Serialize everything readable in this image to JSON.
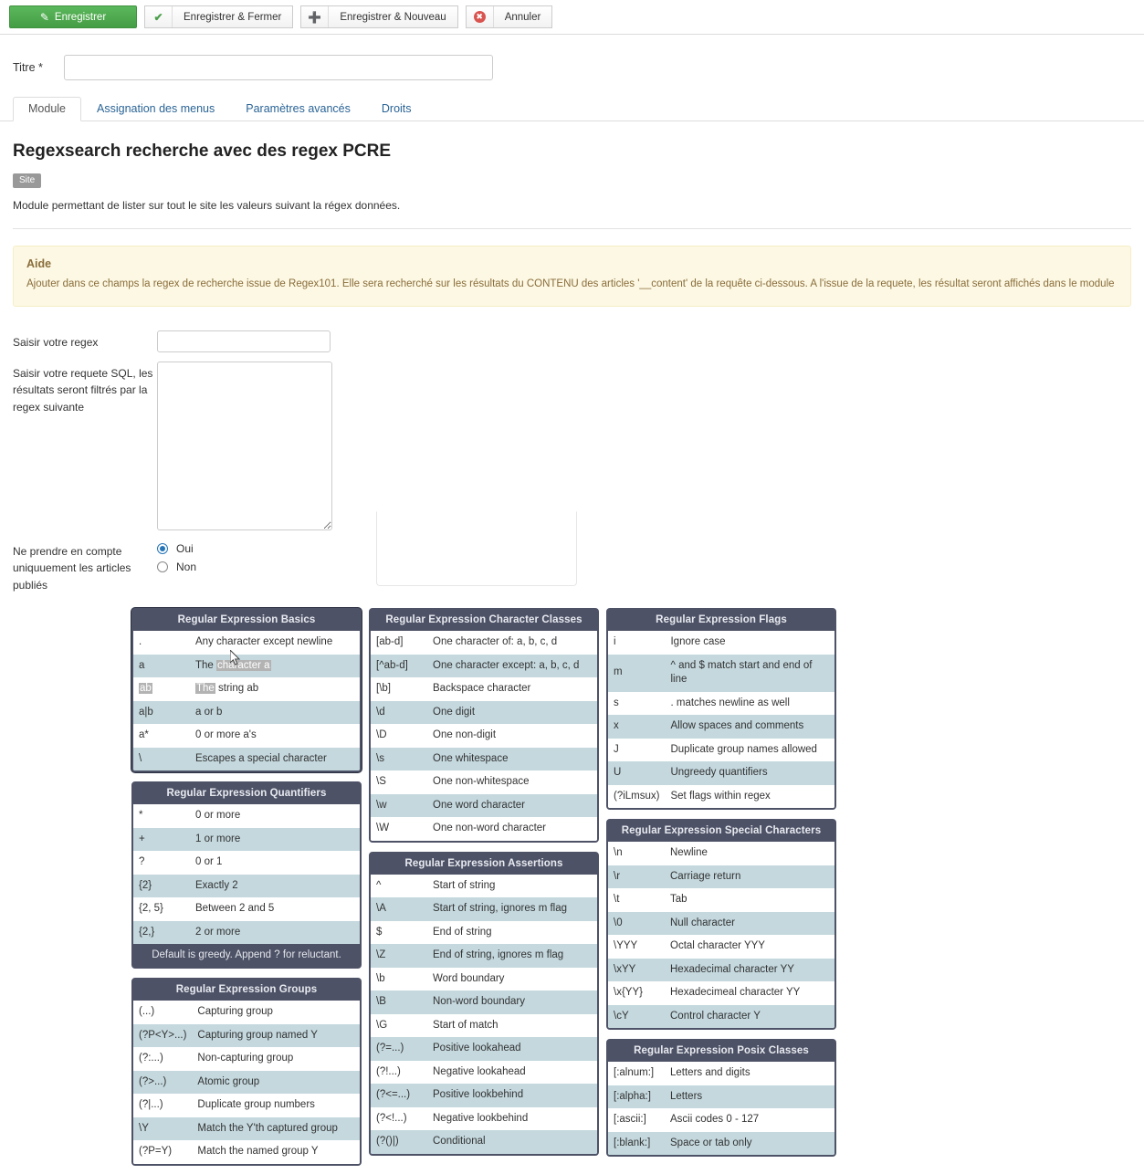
{
  "toolbar": {
    "save": {
      "label": "Enregistrer",
      "icon": "save-icon"
    },
    "save_close": {
      "label": "Enregistrer & Fermer",
      "icon": "check-icon"
    },
    "save_new": {
      "label": "Enregistrer & Nouveau",
      "icon": "plus-icon"
    },
    "cancel": {
      "label": "Annuler",
      "icon": "cancel-icon"
    }
  },
  "title_field": {
    "label": "Titre *",
    "value": "",
    "placeholder": ""
  },
  "tabs": [
    {
      "label": "Module",
      "active": true
    },
    {
      "label": "Assignation des menus",
      "active": false
    },
    {
      "label": "Paramètres avancés",
      "active": false
    },
    {
      "label": "Droits",
      "active": false
    }
  ],
  "module": {
    "heading": "Regexsearch recherche avec des regex PCRE",
    "badge": "Site",
    "description": "Module permettant de lister sur tout le site les valeurs suivant la régex données."
  },
  "alert": {
    "title": "Aide",
    "body": "Ajouter dans ce champs la regex de recherche issue de Regex101. Elle sera recherché sur les résultats du CONTENU des articles '__content' de la requête ci-dessous. A l'issue de la requete, les résultat seront affichés dans le module"
  },
  "form": {
    "regex": {
      "label": "Saisir votre regex",
      "value": "",
      "placeholder": ""
    },
    "sql": {
      "label": "Saisir votre requete SQL, les résultats seront filtrés par la regex suivante",
      "value": "",
      "placeholder": ""
    },
    "published": {
      "label": "Ne prendre en compte uniquuement les articles publiés",
      "options": [
        {
          "label": "Oui",
          "checked": true
        },
        {
          "label": "Non",
          "checked": false
        }
      ]
    }
  },
  "cheatsheet": {
    "basics": {
      "title": "Regular Expression Basics",
      "rows": [
        {
          "key": ".",
          "val": "Any character except newline"
        },
        {
          "key": "a",
          "val": "The character a",
          "sel_val_from": 4
        },
        {
          "key": "ab",
          "val": "The string ab",
          "sel_key": true,
          "sel_val_to": 3
        },
        {
          "key": "a|b",
          "val": "a or b"
        },
        {
          "key": "a*",
          "val": "0 or more a's"
        },
        {
          "key": "\\",
          "val": "Escapes a special character"
        }
      ]
    },
    "quantifiers": {
      "title": "Regular Expression Quantifiers",
      "rows": [
        {
          "key": "*",
          "val": "0 or more"
        },
        {
          "key": "+",
          "val": "1 or more"
        },
        {
          "key": "?",
          "val": "0 or 1"
        },
        {
          "key": "{2}",
          "val": "Exactly 2"
        },
        {
          "key": "{2, 5}",
          "val": "Between 2 and 5"
        },
        {
          "key": "{2,}",
          "val": "2 or more"
        }
      ],
      "footer": "Default is greedy. Append ? for reluctant."
    },
    "groups": {
      "title": "Regular Expression Groups",
      "rows": [
        {
          "key": "(...)",
          "val": "Capturing group"
        },
        {
          "key": "(?P<Y>...)",
          "val": "Capturing group named Y"
        },
        {
          "key": "(?:...)",
          "val": "Non-capturing group"
        },
        {
          "key": "(?>...)",
          "val": "Atomic group"
        },
        {
          "key": "(?|...)",
          "val": "Duplicate group numbers"
        },
        {
          "key": "\\Y",
          "val": "Match the Y'th captured group"
        },
        {
          "key": "(?P=Y)",
          "val": "Match the named group Y"
        }
      ]
    },
    "character_classes": {
      "title": "Regular Expression Character Classes",
      "rows": [
        {
          "key": "[ab-d]",
          "val": "One character of: a, b, c, d"
        },
        {
          "key": "[^ab-d]",
          "val": "One character except: a, b, c, d"
        },
        {
          "key": "[\\b]",
          "val": "Backspace character"
        },
        {
          "key": "\\d",
          "val": "One digit"
        },
        {
          "key": "\\D",
          "val": "One non-digit"
        },
        {
          "key": "\\s",
          "val": "One whitespace"
        },
        {
          "key": "\\S",
          "val": "One non-whitespace"
        },
        {
          "key": "\\w",
          "val": "One word character"
        },
        {
          "key": "\\W",
          "val": "One non-word character"
        }
      ]
    },
    "assertions": {
      "title": "Regular Expression Assertions",
      "rows": [
        {
          "key": "^",
          "val": "Start of string"
        },
        {
          "key": "\\A",
          "val": "Start of string, ignores m flag"
        },
        {
          "key": "$",
          "val": "End of string"
        },
        {
          "key": "\\Z",
          "val": "End of string, ignores m flag"
        },
        {
          "key": "\\b",
          "val": "Word boundary"
        },
        {
          "key": "\\B",
          "val": "Non-word boundary"
        },
        {
          "key": "\\G",
          "val": "Start of match"
        },
        {
          "key": "(?=...)",
          "val": "Positive lookahead"
        },
        {
          "key": "(?!...)",
          "val": "Negative lookahead"
        },
        {
          "key": "(?<=...)",
          "val": "Positive lookbehind"
        },
        {
          "key": "(?<!...)",
          "val": "Negative lookbehind"
        },
        {
          "key": "(?()|)",
          "val": "Conditional"
        }
      ]
    },
    "flags": {
      "title": "Regular Expression Flags",
      "rows": [
        {
          "key": "i",
          "val": "Ignore case"
        },
        {
          "key": "m",
          "val": "^ and $ match start and end of line"
        },
        {
          "key": "s",
          "val": ". matches newline as well"
        },
        {
          "key": "x",
          "val": "Allow spaces and comments"
        },
        {
          "key": "J",
          "val": "Duplicate group names allowed"
        },
        {
          "key": "U",
          "val": "Ungreedy quantifiers"
        },
        {
          "key": "(?iLmsux)",
          "val": "Set flags within regex"
        }
      ]
    },
    "special_characters": {
      "title": "Regular Expression Special Characters",
      "rows": [
        {
          "key": "\\n",
          "val": "Newline"
        },
        {
          "key": "\\r",
          "val": "Carriage return"
        },
        {
          "key": "\\t",
          "val": "Tab"
        },
        {
          "key": "\\0",
          "val": "Null character"
        },
        {
          "key": "\\YYY",
          "val": "Octal character YYY"
        },
        {
          "key": "\\xYY",
          "val": "Hexadecimal character YY"
        },
        {
          "key": "\\x{YY}",
          "val": "Hexadecimeal character YY"
        },
        {
          "key": "\\cY",
          "val": "Control character Y"
        }
      ]
    },
    "posix_classes": {
      "title": "Regular Expression Posix Classes",
      "rows": [
        {
          "key": "[:alnum:]",
          "val": "Letters and digits"
        },
        {
          "key": "[:alpha:]",
          "val": "Letters"
        },
        {
          "key": "[:ascii:]",
          "val": "Ascii codes 0 - 127"
        },
        {
          "key": "[:blank:]",
          "val": "Space or tab only"
        }
      ]
    }
  },
  "colors": {
    "primary_green": "#5cb85c",
    "card_header": "#4d5266",
    "row_alt": "#c4d8de",
    "alert_bg": "#fcf8e3",
    "alert_text": "#8a6d3b",
    "link": "#2a6496",
    "selection": "#b3b3b3",
    "radio_accent": "#2675b8",
    "badge_bg": "#999999"
  }
}
